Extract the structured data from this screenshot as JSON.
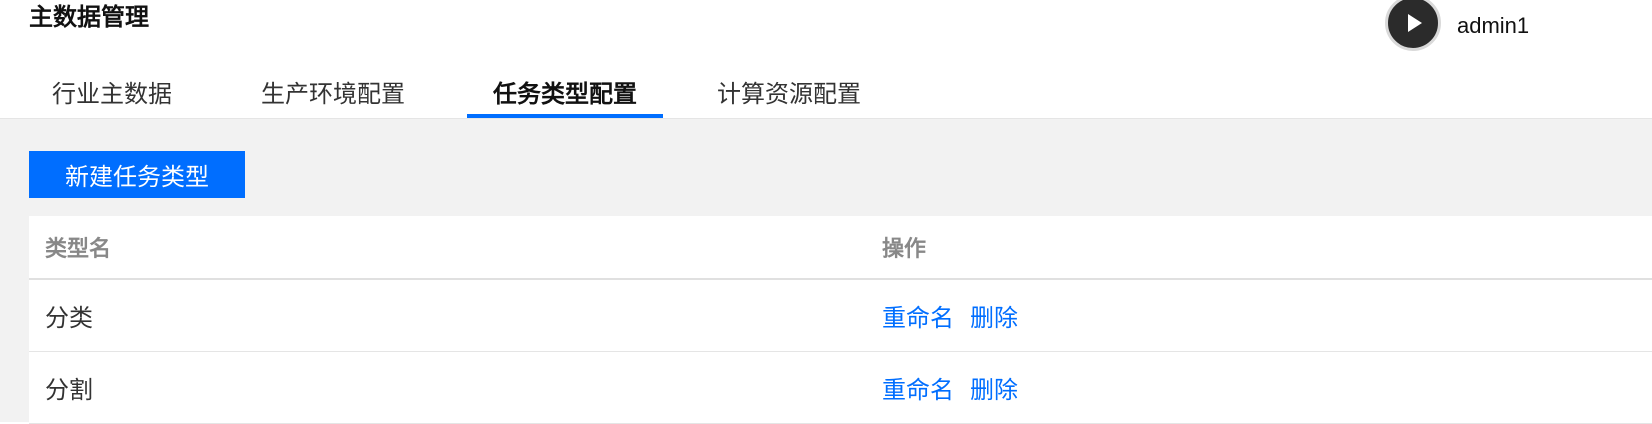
{
  "header": {
    "title": "主数据管理",
    "user": {
      "avatar_icon": "play-icon",
      "name": "admin1"
    }
  },
  "tabs": [
    {
      "label": "行业主数据",
      "active": false
    },
    {
      "label": "生产环境配置",
      "active": false
    },
    {
      "label": "任务类型配置",
      "active": true
    },
    {
      "label": "计算资源配置",
      "active": false
    }
  ],
  "toolbar": {
    "new_button_label": "新建任务类型"
  },
  "table": {
    "columns": [
      "类型名",
      "操作"
    ],
    "rows": [
      {
        "name": "分类",
        "actions": [
          "重命名",
          "删除"
        ]
      },
      {
        "name": "分割",
        "actions": [
          "重命名",
          "删除"
        ]
      }
    ]
  },
  "colors": {
    "accent": "#006eff",
    "content_bg": "#f2f2f2"
  }
}
